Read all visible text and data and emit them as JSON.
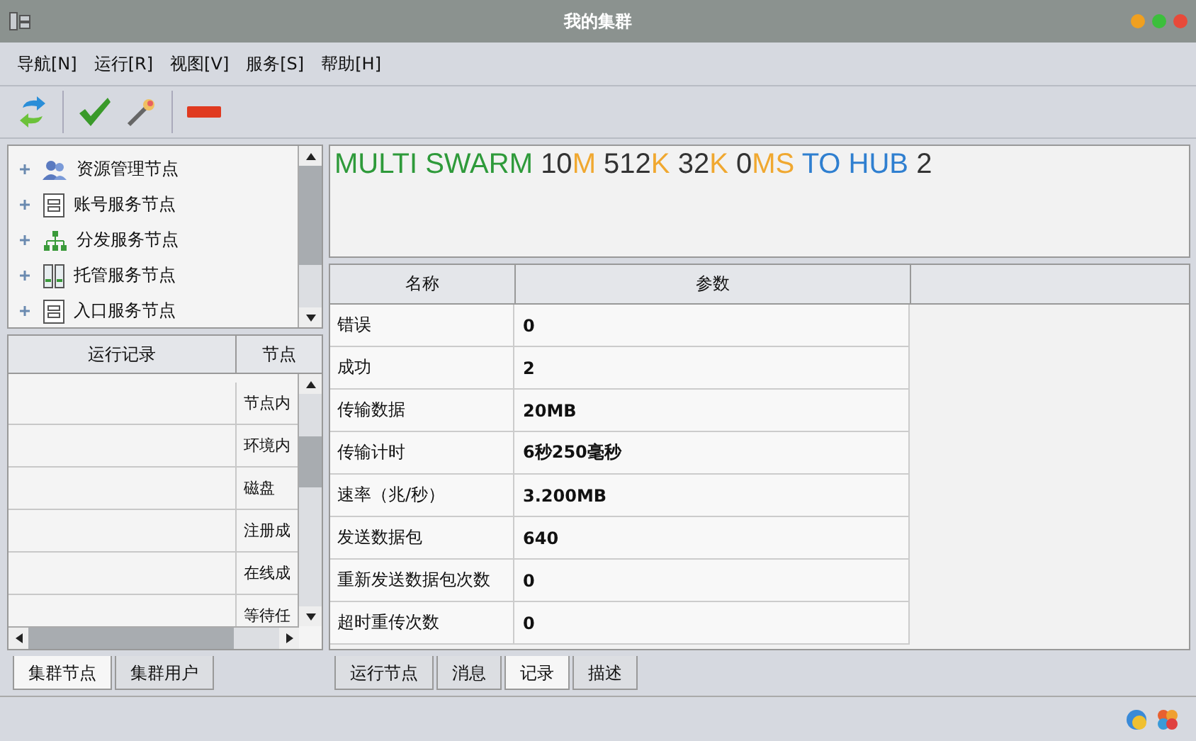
{
  "window": {
    "title": "我的集群"
  },
  "menu": [
    "导航[N]",
    "运行[R]",
    "视图[V]",
    "服务[S]",
    "帮助[H]"
  ],
  "tree": {
    "items": [
      {
        "label": "资源管理节点",
        "kind": "users"
      },
      {
        "label": "账号服务节点",
        "kind": "document"
      },
      {
        "label": "分发服务节点",
        "kind": "hierarchy"
      },
      {
        "label": "托管服务节点",
        "kind": "columns"
      },
      {
        "label": "入口服务节点",
        "kind": "document"
      }
    ]
  },
  "log_table": {
    "columns": [
      "运行记录",
      "节点"
    ],
    "rows": [
      [
        "",
        "节点内"
      ],
      [
        "",
        "环境内"
      ],
      [
        "",
        "磁盘"
      ],
      [
        "",
        "注册成"
      ],
      [
        "",
        "在线成"
      ],
      [
        "",
        "等待任"
      ]
    ]
  },
  "left_tabs": [
    {
      "label": "集群节点",
      "selected": true
    },
    {
      "label": "集群用户",
      "selected": false
    }
  ],
  "banner": [
    {
      "text": "MULTI SWARM",
      "color": "#2e9a3a"
    },
    {
      "text": "10",
      "color": "#333333"
    },
    {
      "text": "M",
      "color": "#f0a830"
    },
    {
      "text": "512",
      "color": "#333333"
    },
    {
      "text": "K",
      "color": "#f0a830"
    },
    {
      "text": "32",
      "color": "#333333"
    },
    {
      "text": "K",
      "color": "#f0a830"
    },
    {
      "text": "0",
      "color": "#333333"
    },
    {
      "text": "MS",
      "color": "#f0a830"
    },
    {
      "text": "TO HUB",
      "color": "#2f7fd0"
    },
    {
      "text": "2",
      "color": "#333333"
    }
  ],
  "param_table": {
    "columns": [
      "名称",
      "参数"
    ],
    "rows": [
      [
        "错误",
        "0"
      ],
      [
        "成功",
        "2"
      ],
      [
        "传输数据",
        "20MB"
      ],
      [
        "传输计时",
        "6秒250毫秒"
      ],
      [
        "速率（兆/秒）",
        "3.200MB"
      ],
      [
        "发送数据包",
        "640"
      ],
      [
        "重新发送数据包次数",
        "0"
      ],
      [
        "超时重传次数",
        "0"
      ]
    ]
  },
  "right_tabs": [
    {
      "label": "运行节点",
      "selected": false
    },
    {
      "label": "消息",
      "selected": false
    },
    {
      "label": "记录",
      "selected": true
    },
    {
      "label": "描述",
      "selected": false
    }
  ]
}
